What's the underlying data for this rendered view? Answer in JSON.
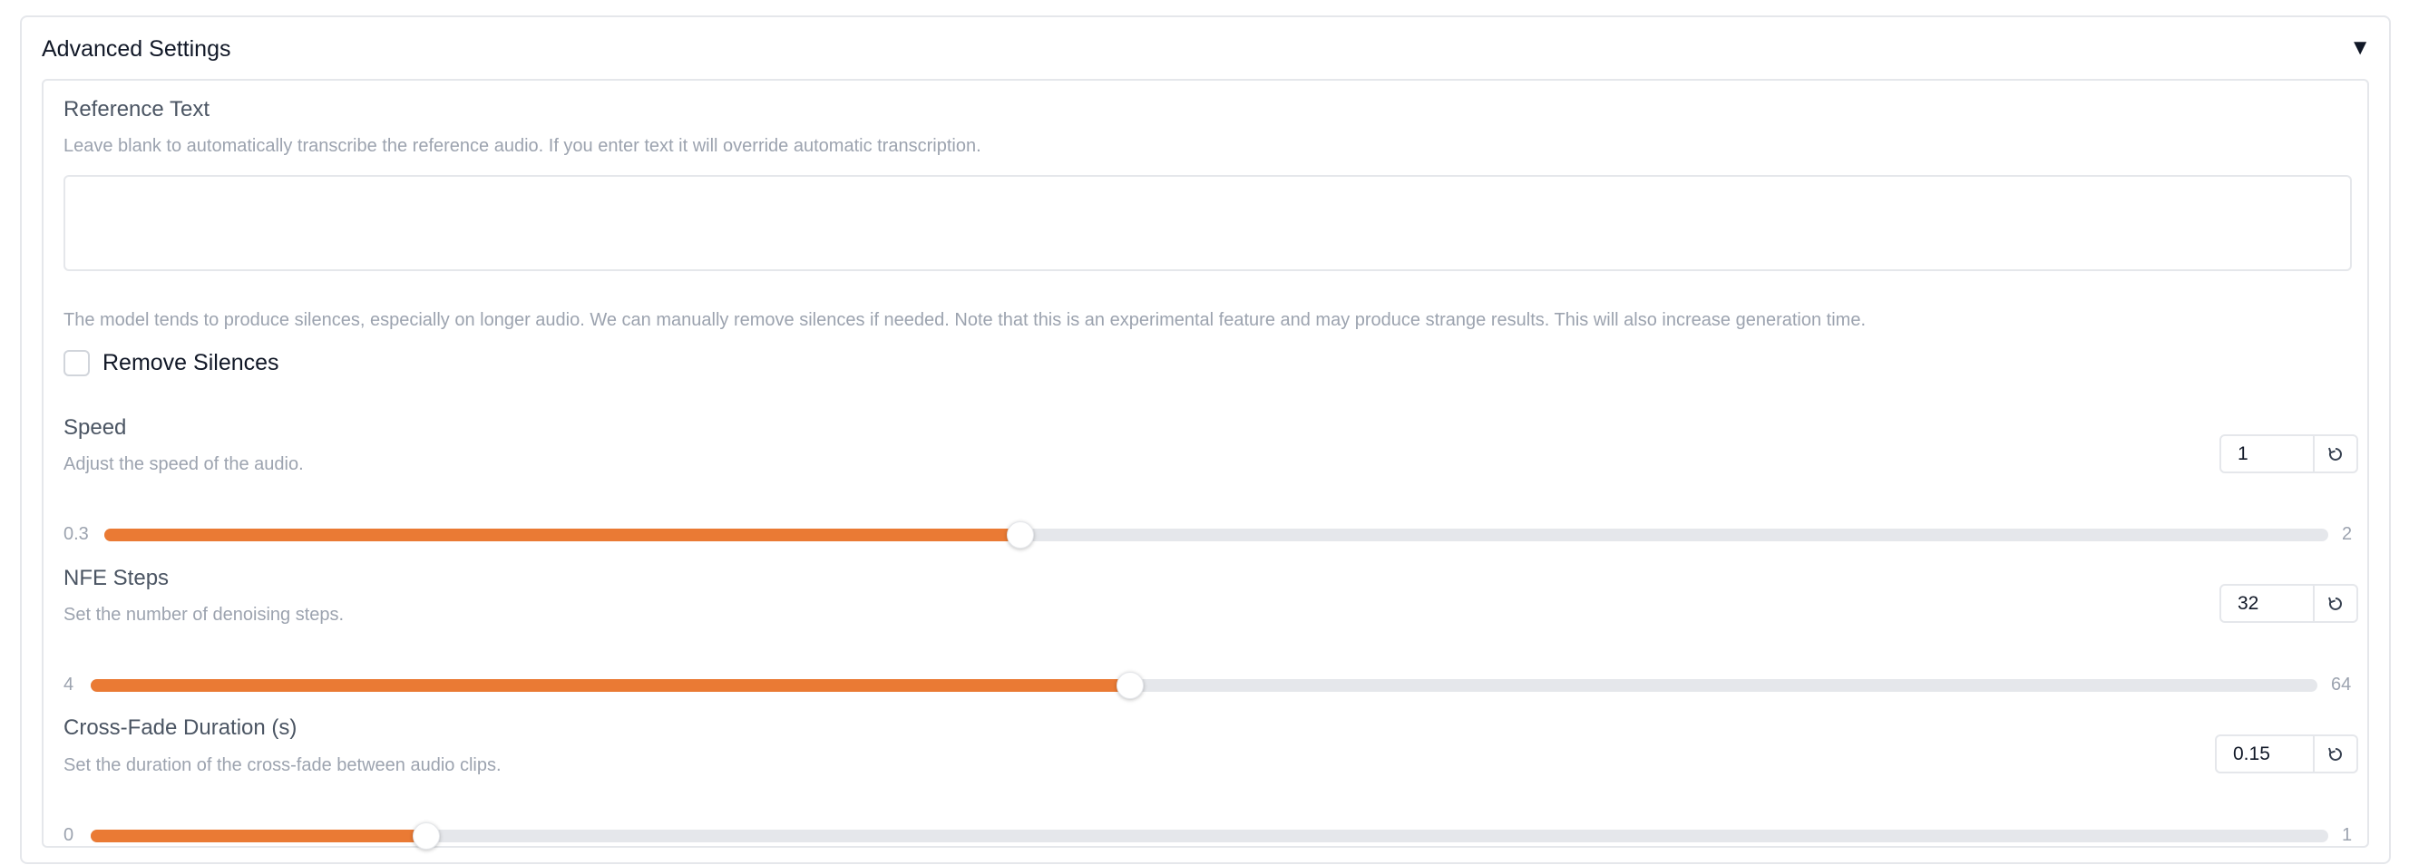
{
  "accordion": {
    "title": "Advanced Settings",
    "toggle_icon": "triangle-down-icon",
    "toggle_glyph": "▼"
  },
  "reference_text": {
    "label": "Reference Text",
    "info": "Leave blank to automatically transcribe the reference audio. If you enter text it will override automatic transcription.",
    "value": "",
    "placeholder": ""
  },
  "remove_silences": {
    "info": "The model tends to produce silences, especially on longer audio. We can manually remove silences if needed. Note that this is an experimental feature and may produce strange results. This will also increase generation time.",
    "label": "Remove Silences",
    "checked": false
  },
  "sliders": {
    "speed": {
      "label": "Speed",
      "info": "Adjust the speed of the audio.",
      "value": "1",
      "min": "0.3",
      "max": "2",
      "fraction": 0.4118,
      "reset_icon": "reset-icon"
    },
    "nfe_steps": {
      "label": "NFE Steps",
      "info": "Set the number of denoising steps.",
      "value": "32",
      "min": "4",
      "max": "64",
      "fraction": 0.4667,
      "reset_icon": "reset-icon"
    },
    "cross_fade": {
      "label": "Cross-Fade Duration (s)",
      "info": "Set the duration of the cross-fade between audio clips.",
      "value": "0.15",
      "min": "0",
      "max": "1",
      "fraction": 0.15,
      "reset_icon": "reset-icon"
    }
  },
  "colors": {
    "accent": "#ea7a34",
    "track": "#e5e7eb",
    "border": "#e5e7eb",
    "muted_text": "#9ca3af"
  }
}
